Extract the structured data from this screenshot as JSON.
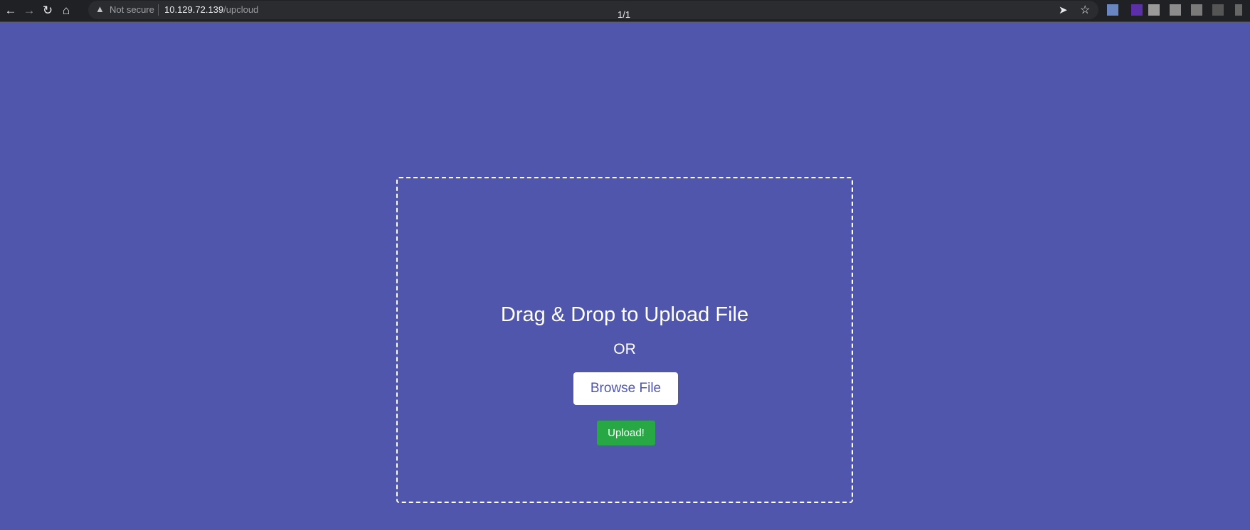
{
  "browser": {
    "security_label": "Not secure",
    "url_host": "10.129.72.139",
    "url_path": "/upcloud",
    "find_counter": "1/1"
  },
  "page": {
    "title": "Drag & Drop to Upload File",
    "or_label": "OR",
    "browse_label": "Browse File",
    "upload_label": "Upload!"
  },
  "colors": {
    "background": "#5056ac",
    "upload_button": "#28a745"
  }
}
